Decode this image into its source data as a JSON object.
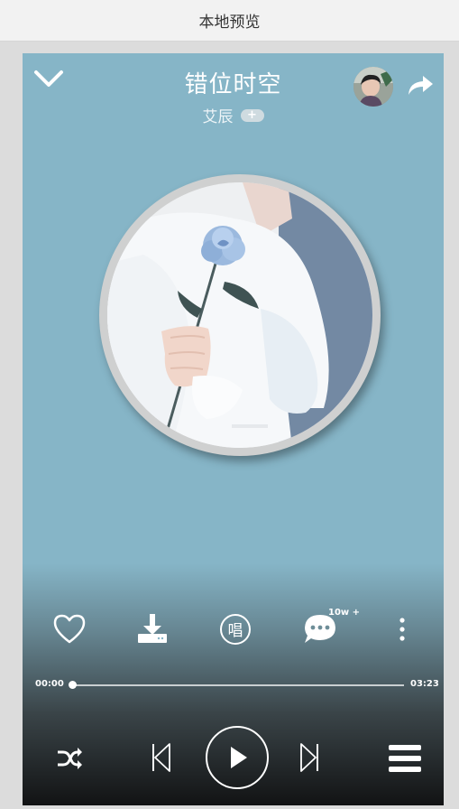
{
  "window": {
    "title": "本地预览"
  },
  "song": {
    "title": "错位时空",
    "artist": "艾辰",
    "follow_label": "+"
  },
  "actions": {
    "comment_count": "10w +",
    "karaoke_label": "唱"
  },
  "progress": {
    "current_time": "00:00",
    "total_time": "03:23",
    "fraction": 0.0
  },
  "icons": {
    "back": "chevron-down-icon",
    "share": "share-arrow-icon",
    "like": "heart-icon",
    "download": "download-icon",
    "karaoke": "sing-icon",
    "comment": "comment-icon",
    "more": "more-vertical-icon",
    "shuffle": "shuffle-icon",
    "prev": "skip-previous-icon",
    "play": "play-icon",
    "next": "skip-next-icon",
    "playlist": "playlist-icon"
  },
  "colors": {
    "background": "#86b5c7",
    "accent": "#ffffff"
  }
}
